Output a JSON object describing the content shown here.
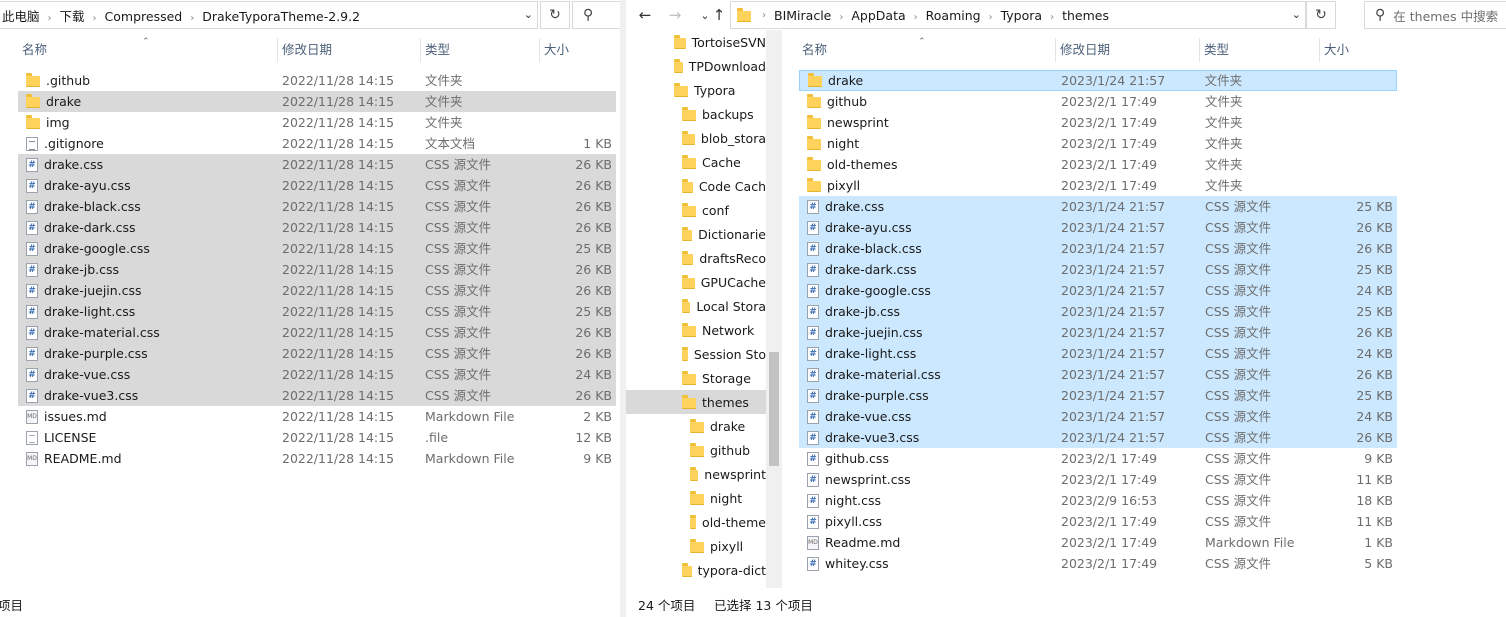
{
  "left": {
    "breadcrumb": [
      "此电脑",
      "下载",
      "Compressed",
      "DrakeTyporaTheme-2.9.2"
    ],
    "columns": {
      "name": "名称",
      "date": "修改日期",
      "type": "类型",
      "size": "大小"
    },
    "files": [
      {
        "name": ".github",
        "date": "2022/11/28 14:15",
        "type": "文件夹",
        "size": "",
        "icon": "folder",
        "selected": false
      },
      {
        "name": "drake",
        "date": "2022/11/28 14:15",
        "type": "文件夹",
        "size": "",
        "icon": "folder",
        "selected": true
      },
      {
        "name": "img",
        "date": "2022/11/28 14:15",
        "type": "文件夹",
        "size": "",
        "icon": "folder",
        "selected": false
      },
      {
        "name": ".gitignore",
        "date": "2022/11/28 14:15",
        "type": "文本文档",
        "size": "1 KB",
        "icon": "txt",
        "selected": false
      },
      {
        "name": "drake.css",
        "date": "2022/11/28 14:15",
        "type": "CSS 源文件",
        "size": "26 KB",
        "icon": "css",
        "selected": true
      },
      {
        "name": "drake-ayu.css",
        "date": "2022/11/28 14:15",
        "type": "CSS 源文件",
        "size": "26 KB",
        "icon": "css",
        "selected": true
      },
      {
        "name": "drake-black.css",
        "date": "2022/11/28 14:15",
        "type": "CSS 源文件",
        "size": "26 KB",
        "icon": "css",
        "selected": true
      },
      {
        "name": "drake-dark.css",
        "date": "2022/11/28 14:15",
        "type": "CSS 源文件",
        "size": "26 KB",
        "icon": "css",
        "selected": true
      },
      {
        "name": "drake-google.css",
        "date": "2022/11/28 14:15",
        "type": "CSS 源文件",
        "size": "25 KB",
        "icon": "css",
        "selected": true
      },
      {
        "name": "drake-jb.css",
        "date": "2022/11/28 14:15",
        "type": "CSS 源文件",
        "size": "26 KB",
        "icon": "css",
        "selected": true
      },
      {
        "name": "drake-juejin.css",
        "date": "2022/11/28 14:15",
        "type": "CSS 源文件",
        "size": "26 KB",
        "icon": "css",
        "selected": true
      },
      {
        "name": "drake-light.css",
        "date": "2022/11/28 14:15",
        "type": "CSS 源文件",
        "size": "25 KB",
        "icon": "css",
        "selected": true
      },
      {
        "name": "drake-material.css",
        "date": "2022/11/28 14:15",
        "type": "CSS 源文件",
        "size": "26 KB",
        "icon": "css",
        "selected": true
      },
      {
        "name": "drake-purple.css",
        "date": "2022/11/28 14:15",
        "type": "CSS 源文件",
        "size": "26 KB",
        "icon": "css",
        "selected": true
      },
      {
        "name": "drake-vue.css",
        "date": "2022/11/28 14:15",
        "type": "CSS 源文件",
        "size": "24 KB",
        "icon": "css",
        "selected": true
      },
      {
        "name": "drake-vue3.css",
        "date": "2022/11/28 14:15",
        "type": "CSS 源文件",
        "size": "26 KB",
        "icon": "css",
        "selected": true
      },
      {
        "name": "issues.md",
        "date": "2022/11/28 14:15",
        "type": "Markdown File",
        "size": "2 KB",
        "icon": "md",
        "selected": false
      },
      {
        "name": "LICENSE",
        "date": "2022/11/28 14:15",
        "type": ".file",
        "size": "12 KB",
        "icon": "doc",
        "selected": false
      },
      {
        "name": "README.md",
        "date": "2022/11/28 14:15",
        "type": "Markdown File",
        "size": "9 KB",
        "icon": "md",
        "selected": false
      }
    ],
    "status": "项目"
  },
  "right": {
    "breadcrumb": [
      "BIMiracle",
      "AppData",
      "Roaming",
      "Typora",
      "themes"
    ],
    "search_placeholder": "在 themes 中搜索",
    "columns": {
      "name": "名称",
      "date": "修改日期",
      "type": "类型",
      "size": "大小"
    },
    "tree": [
      {
        "name": "TortoiseSVN",
        "level": 0,
        "selected": false
      },
      {
        "name": "TPDownload",
        "level": 0,
        "selected": false
      },
      {
        "name": "Typora",
        "level": 0,
        "selected": false
      },
      {
        "name": "backups",
        "level": 1,
        "selected": false
      },
      {
        "name": "blob_stora",
        "level": 1,
        "selected": false
      },
      {
        "name": "Cache",
        "level": 1,
        "selected": false
      },
      {
        "name": "Code Cach",
        "level": 1,
        "selected": false
      },
      {
        "name": "conf",
        "level": 1,
        "selected": false
      },
      {
        "name": "Dictionarie",
        "level": 1,
        "selected": false
      },
      {
        "name": "draftsReco",
        "level": 1,
        "selected": false
      },
      {
        "name": "GPUCache",
        "level": 1,
        "selected": false
      },
      {
        "name": "Local Stora",
        "level": 1,
        "selected": false
      },
      {
        "name": "Network",
        "level": 1,
        "selected": false
      },
      {
        "name": "Session Sto",
        "level": 1,
        "selected": false
      },
      {
        "name": "Storage",
        "level": 1,
        "selected": false
      },
      {
        "name": "themes",
        "level": 1,
        "selected": true
      },
      {
        "name": "drake",
        "level": 2,
        "selected": false
      },
      {
        "name": "github",
        "level": 2,
        "selected": false
      },
      {
        "name": "newsprint",
        "level": 2,
        "selected": false
      },
      {
        "name": "night",
        "level": 2,
        "selected": false
      },
      {
        "name": "old-theme",
        "level": 2,
        "selected": false
      },
      {
        "name": "pixyll",
        "level": 2,
        "selected": false
      },
      {
        "name": "typora-dict",
        "level": 1,
        "selected": false
      }
    ],
    "files": [
      {
        "name": "drake",
        "date": "2023/1/24 21:57",
        "type": "文件夹",
        "size": "",
        "icon": "folder",
        "selected": true
      },
      {
        "name": "github",
        "date": "2023/2/1 17:49",
        "type": "文件夹",
        "size": "",
        "icon": "folder",
        "selected": false
      },
      {
        "name": "newsprint",
        "date": "2023/2/1 17:49",
        "type": "文件夹",
        "size": "",
        "icon": "folder",
        "selected": false
      },
      {
        "name": "night",
        "date": "2023/2/1 17:49",
        "type": "文件夹",
        "size": "",
        "icon": "folder",
        "selected": false
      },
      {
        "name": "old-themes",
        "date": "2023/2/1 17:49",
        "type": "文件夹",
        "size": "",
        "icon": "folder",
        "selected": false
      },
      {
        "name": "pixyll",
        "date": "2023/2/1 17:49",
        "type": "文件夹",
        "size": "",
        "icon": "folder",
        "selected": false
      },
      {
        "name": "drake.css",
        "date": "2023/1/24 21:57",
        "type": "CSS 源文件",
        "size": "25 KB",
        "icon": "css",
        "selected": true
      },
      {
        "name": "drake-ayu.css",
        "date": "2023/1/24 21:57",
        "type": "CSS 源文件",
        "size": "26 KB",
        "icon": "css",
        "selected": true
      },
      {
        "name": "drake-black.css",
        "date": "2023/1/24 21:57",
        "type": "CSS 源文件",
        "size": "26 KB",
        "icon": "css",
        "selected": true
      },
      {
        "name": "drake-dark.css",
        "date": "2023/1/24 21:57",
        "type": "CSS 源文件",
        "size": "25 KB",
        "icon": "css",
        "selected": true
      },
      {
        "name": "drake-google.css",
        "date": "2023/1/24 21:57",
        "type": "CSS 源文件",
        "size": "24 KB",
        "icon": "css",
        "selected": true
      },
      {
        "name": "drake-jb.css",
        "date": "2023/1/24 21:57",
        "type": "CSS 源文件",
        "size": "25 KB",
        "icon": "css",
        "selected": true
      },
      {
        "name": "drake-juejin.css",
        "date": "2023/1/24 21:57",
        "type": "CSS 源文件",
        "size": "26 KB",
        "icon": "css",
        "selected": true
      },
      {
        "name": "drake-light.css",
        "date": "2023/1/24 21:57",
        "type": "CSS 源文件",
        "size": "24 KB",
        "icon": "css",
        "selected": true
      },
      {
        "name": "drake-material.css",
        "date": "2023/1/24 21:57",
        "type": "CSS 源文件",
        "size": "26 KB",
        "icon": "css",
        "selected": true
      },
      {
        "name": "drake-purple.css",
        "date": "2023/1/24 21:57",
        "type": "CSS 源文件",
        "size": "25 KB",
        "icon": "css",
        "selected": true
      },
      {
        "name": "drake-vue.css",
        "date": "2023/1/24 21:57",
        "type": "CSS 源文件",
        "size": "24 KB",
        "icon": "css",
        "selected": true
      },
      {
        "name": "drake-vue3.css",
        "date": "2023/1/24 21:57",
        "type": "CSS 源文件",
        "size": "26 KB",
        "icon": "css",
        "selected": true
      },
      {
        "name": "github.css",
        "date": "2023/2/1 17:49",
        "type": "CSS 源文件",
        "size": "9 KB",
        "icon": "css",
        "selected": false
      },
      {
        "name": "newsprint.css",
        "date": "2023/2/1 17:49",
        "type": "CSS 源文件",
        "size": "11 KB",
        "icon": "css",
        "selected": false
      },
      {
        "name": "night.css",
        "date": "2023/2/9 16:53",
        "type": "CSS 源文件",
        "size": "18 KB",
        "icon": "css",
        "selected": false
      },
      {
        "name": "pixyll.css",
        "date": "2023/2/1 17:49",
        "type": "CSS 源文件",
        "size": "11 KB",
        "icon": "css",
        "selected": false
      },
      {
        "name": "Readme.md",
        "date": "2023/2/1 17:49",
        "type": "Markdown File",
        "size": "1 KB",
        "icon": "md",
        "selected": false
      },
      {
        "name": "whitey.css",
        "date": "2023/2/1 17:49",
        "type": "CSS 源文件",
        "size": "5 KB",
        "icon": "css",
        "selected": false
      }
    ],
    "status_count": "24 个项目",
    "status_selected": "已选择 13 个项目"
  },
  "icons": {
    "back": "back-arrow-icon",
    "forward": "forward-arrow-icon",
    "up": "up-arrow-icon",
    "refresh": "refresh-icon",
    "search": "search-icon",
    "dropdown": "chevron-down-icon"
  },
  "colors": {
    "selected_blue": "#cce8ff",
    "selected_gray": "#d9d9d9",
    "folder": "#ffd35b",
    "header_text": "#4c607a"
  }
}
